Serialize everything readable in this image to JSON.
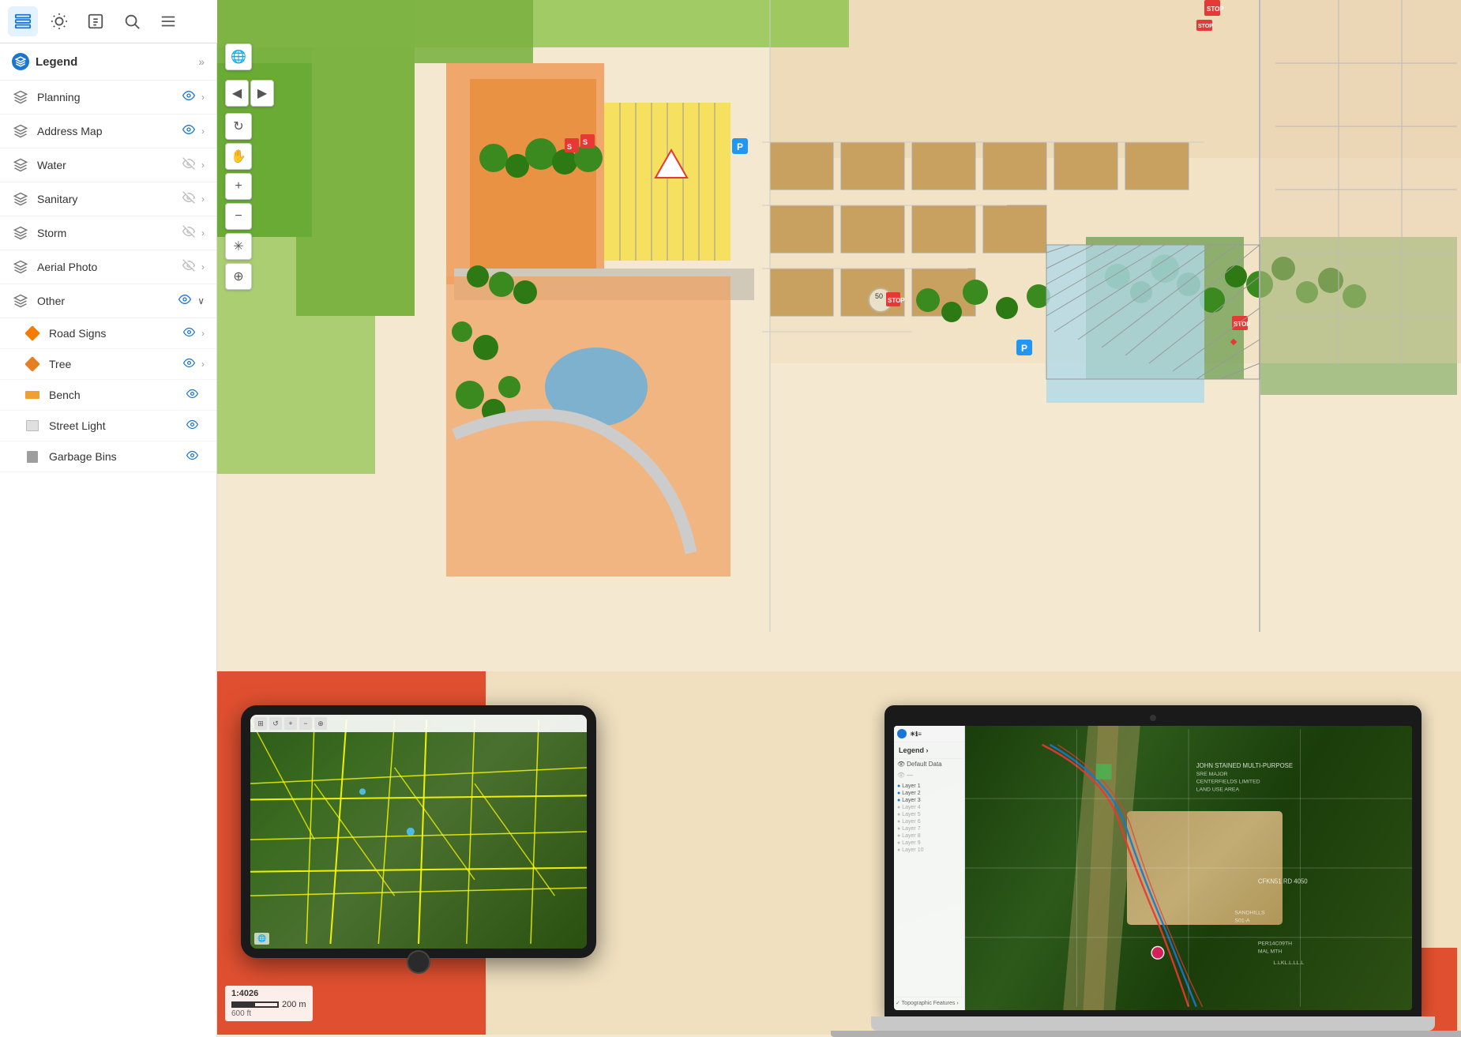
{
  "toolbar": {
    "buttons": [
      {
        "id": "layers",
        "icon": "⊞",
        "label": "Layers",
        "active": true
      },
      {
        "id": "light",
        "icon": "☀",
        "label": "Light",
        "active": false
      },
      {
        "id": "info",
        "icon": "ℹ",
        "label": "Info",
        "active": false
      },
      {
        "id": "search",
        "icon": "🔍",
        "label": "Search",
        "active": false
      },
      {
        "id": "menu",
        "icon": "≡",
        "label": "Menu",
        "active": false
      }
    ]
  },
  "sidebar": {
    "legend_title": "Legend",
    "layers": [
      {
        "id": "planning",
        "name": "Planning",
        "visible": true,
        "has_arrow": true,
        "expanded": false,
        "indent": 0
      },
      {
        "id": "address-map",
        "name": "Address Map",
        "visible": true,
        "has_arrow": true,
        "expanded": false,
        "indent": 0
      },
      {
        "id": "water",
        "name": "Water",
        "visible": false,
        "has_arrow": true,
        "expanded": false,
        "indent": 0
      },
      {
        "id": "sanitary",
        "name": "Sanitary",
        "visible": false,
        "has_arrow": true,
        "expanded": false,
        "indent": 0
      },
      {
        "id": "storm",
        "name": "Storm",
        "visible": false,
        "has_arrow": true,
        "expanded": false,
        "indent": 0
      },
      {
        "id": "aerial-photo",
        "name": "Aerial Photo",
        "visible": false,
        "has_arrow": true,
        "expanded": false,
        "indent": 0
      },
      {
        "id": "other",
        "name": "Other",
        "visible": true,
        "has_arrow": true,
        "expanded": true,
        "indent": 0
      }
    ],
    "sublayers": [
      {
        "id": "road-signs",
        "name": "Road Signs",
        "visible": true,
        "icon_type": "road-sign",
        "has_arrow": true
      },
      {
        "id": "tree",
        "name": "Tree",
        "visible": true,
        "icon_type": "tree",
        "has_arrow": true
      },
      {
        "id": "bench",
        "name": "Bench",
        "visible": true,
        "icon_type": "bench",
        "has_arrow": false
      },
      {
        "id": "street-light",
        "name": "Street Light",
        "visible": true,
        "icon_type": "streetlight",
        "has_arrow": false
      },
      {
        "id": "garbage-bins",
        "name": "Garbage Bins",
        "visible": true,
        "icon_type": "garbage",
        "has_arrow": false
      }
    ]
  },
  "map_controls": {
    "globe_btn": "🌐",
    "back_btn": "◀",
    "forward_btn": "▶",
    "refresh_btn": "↻",
    "pan_btn": "✋",
    "zoom_in_btn": "+",
    "zoom_out_btn": "−",
    "asterisk_btn": "✳",
    "target_btn": "⊕"
  },
  "scale": {
    "ratio": "1:4026",
    "metric": "200 m",
    "imperial": "600 ft"
  },
  "devices": {
    "tablet": {
      "label": "Tablet aerial view",
      "description": "Aerial photo with yellow survey lines"
    },
    "laptop": {
      "label": "Laptop map view",
      "description": "Aerial photo with pipeline overlays",
      "sidebar_items": [
        "Legend",
        "Default Data",
        "null"
      ]
    }
  }
}
